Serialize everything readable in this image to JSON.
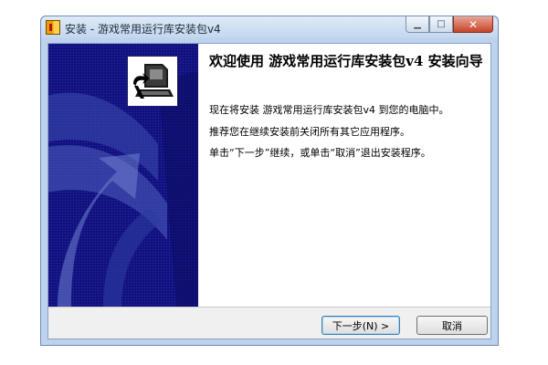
{
  "window": {
    "title": "安装 - 游戏常用运行库安装包v4",
    "minimize_glyph": "▁",
    "maximize_glyph": "□",
    "close_glyph": "✕"
  },
  "content": {
    "title": "欢迎使用 游戏常用运行库安装包v4 安装向导",
    "paragraphs": [
      "现在将安装 游戏常用运行库安装包v4 到您的电脑中。",
      "推荐您在继续安装前关闭所有其它应用程序。",
      "单击“下一步”继续，或单击“取消”退出安装程序。"
    ]
  },
  "footer": {
    "next_label": "下一步(N) >",
    "cancel_label": "取消"
  },
  "colors": {
    "sidebar": "#0f0f7a",
    "close_button": "#c7442a"
  },
  "icons": {
    "app": "installer-app-icon",
    "setup": "setup-computer-icon"
  }
}
